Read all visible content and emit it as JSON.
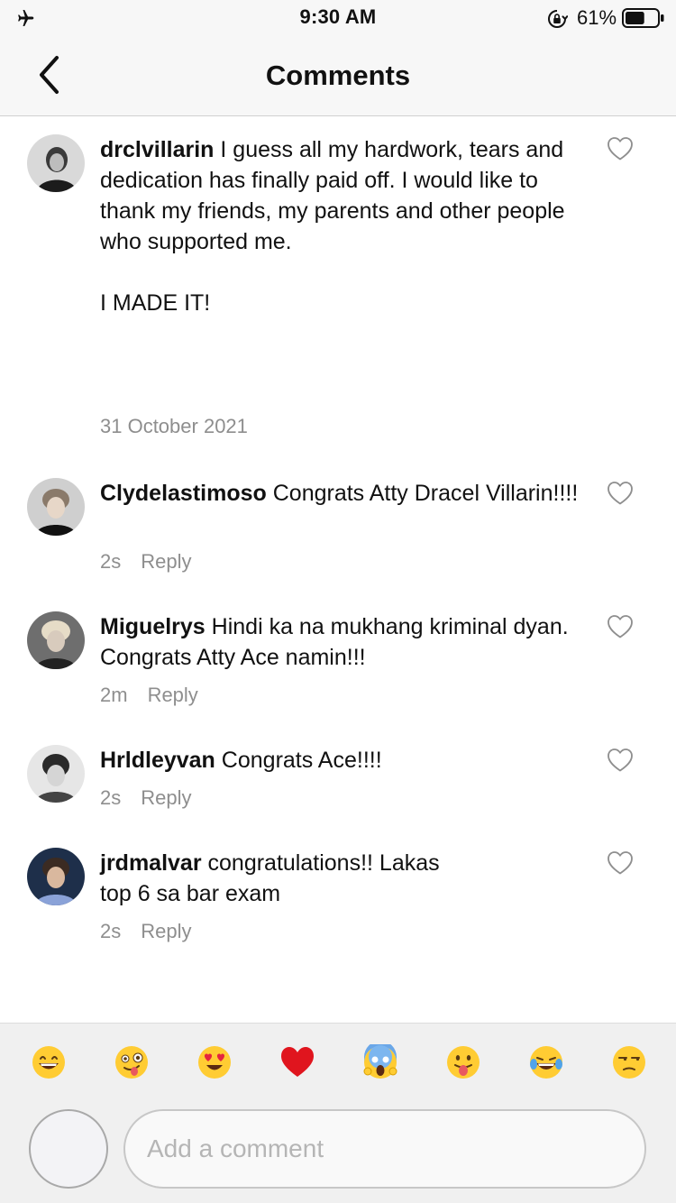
{
  "status_bar": {
    "time": "9:30 AM",
    "battery_percent": "61%",
    "battery_level": 0.61,
    "icons": [
      "airplane-icon",
      "orientation-lock-icon",
      "battery-icon"
    ]
  },
  "header": {
    "title": "Comments",
    "back_icon": "chevron-left-icon"
  },
  "caption": {
    "username": "drclvillarin",
    "text": "I guess all my hardwork, tears and dedication has finally paid off. I would like to thank my friends, my parents and other people who supported me.\n\nI MADE IT!",
    "date": "31 October 2021"
  },
  "comments": [
    {
      "username": "Clydelastimoso",
      "text": "Congrats Atty Dracel Villarin!!!!",
      "time": "2s",
      "reply_label": "Reply"
    },
    {
      "username": "Miguelrys",
      "text": "Hindi ka na mukhang kriminal dyan. Congrats Atty Ace namin!!!",
      "time": "2m",
      "reply_label": "Reply"
    },
    {
      "username": "Hrldleyvan",
      "text": "Congrats Ace!!!!",
      "time": "2s",
      "reply_label": "Reply"
    },
    {
      "username": "jrdmalvar",
      "text": "congratulations!! Lakas\ntop 6 sa bar exam",
      "time": "2s",
      "reply_label": "Reply"
    }
  ],
  "emoji_bar": [
    "grinning-face",
    "winking-face-with-tongue",
    "heart-eyes",
    "red-heart",
    "screaming-face",
    "face-with-tongue",
    "tears-of-joy",
    "unamused-face"
  ],
  "composer": {
    "placeholder": "Add a comment"
  },
  "colors": {
    "meta_gray": "#8e8e8e",
    "bar_background": "#f7f7f7",
    "heart_outline": "#8e8e8e"
  }
}
